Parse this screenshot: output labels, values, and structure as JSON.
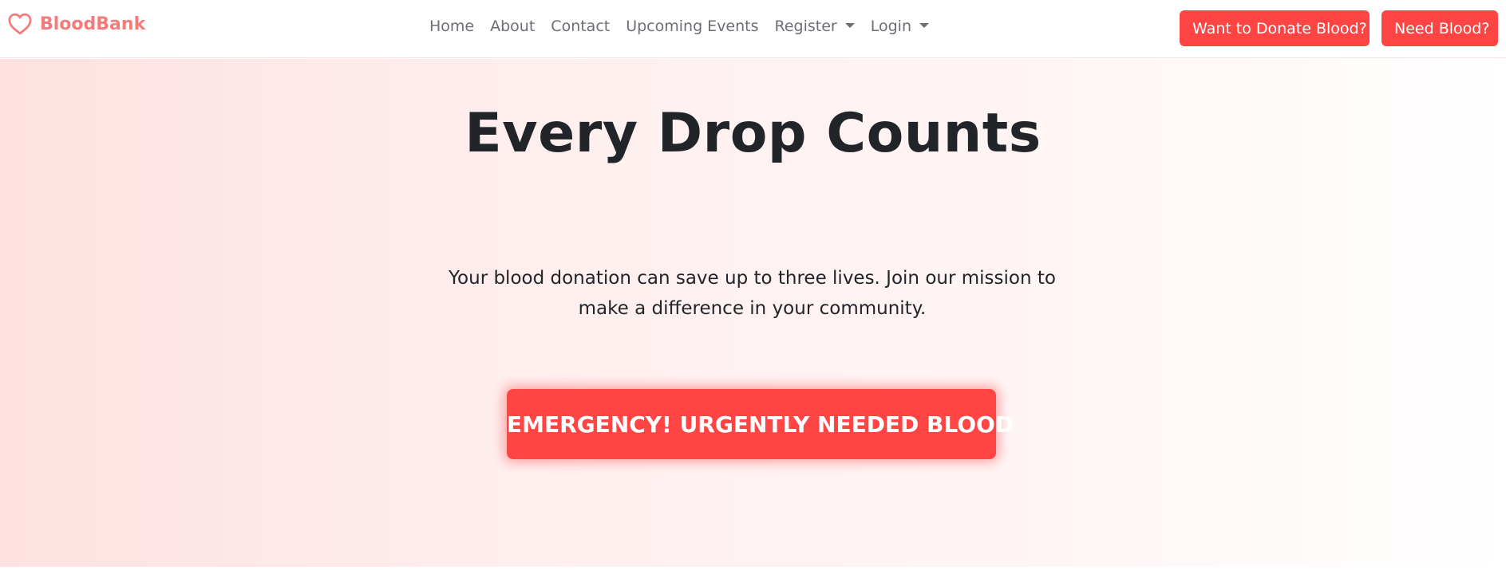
{
  "navbar": {
    "brand": {
      "name": "BloodBank",
      "icon": "heart-icon",
      "color": "#f47b7b"
    },
    "links": [
      {
        "label": "Home"
      },
      {
        "label": "About"
      },
      {
        "label": "Contact"
      },
      {
        "label": "Upcoming Events"
      },
      {
        "label": "Register",
        "dropdown": true
      },
      {
        "label": "Login",
        "dropdown": true
      }
    ],
    "actions": {
      "donate_label": "Want to Donate Blood?",
      "need_label": "Need Blood?"
    },
    "accent_color": "#ff4444"
  },
  "hero": {
    "title": "Every Drop Counts",
    "text": "Your blood donation can save up to three lives. Join our mission to make a difference in your community.",
    "cta_label": "EMERGENCY! URGENTLY NEEDED BLOOD"
  }
}
